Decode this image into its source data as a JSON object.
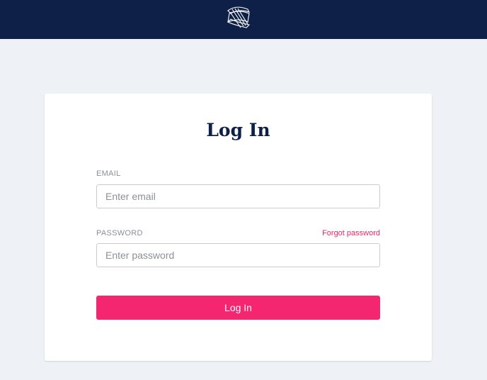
{
  "header": {
    "logo_icon": "brand-logo-icon",
    "background_color": "#0e2047"
  },
  "login": {
    "title": "Log In",
    "email_label": "EMAIL",
    "email_placeholder": "Enter email",
    "email_value": "",
    "password_label": "PASSWORD",
    "forgot_link": "Forgot password",
    "password_placeholder": "Enter password",
    "password_value": "",
    "submit_label": "Log In",
    "accent_color": "#f52670"
  }
}
